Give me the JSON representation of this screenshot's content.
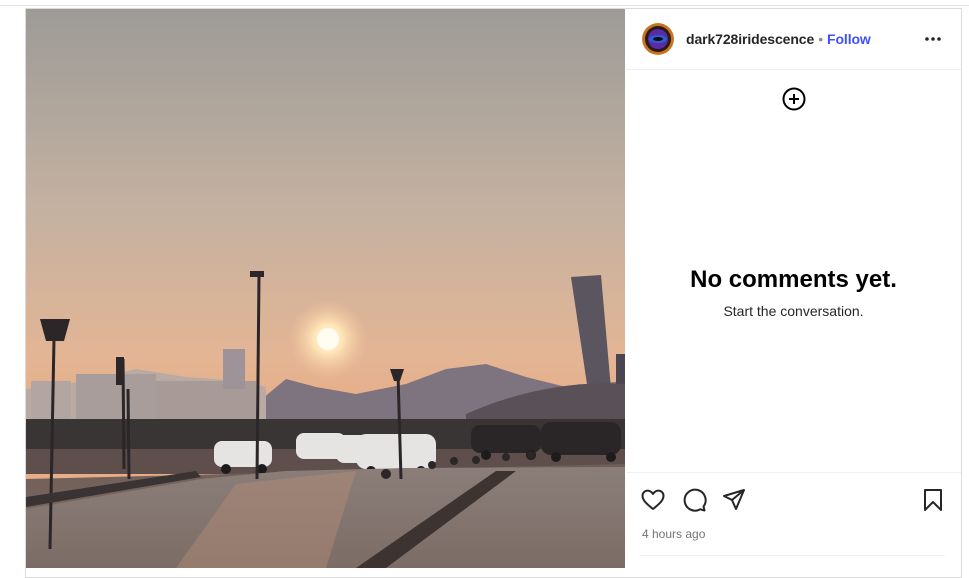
{
  "post": {
    "username": "dark728iridescence",
    "separator": "•",
    "follow_label": "Follow",
    "more_icon": "more-horizontal-icon"
  },
  "comments": {
    "empty_title": "No comments yet.",
    "empty_subtitle": "Start the conversation.",
    "add_icon": "plus-circle-icon"
  },
  "actions": {
    "like_icon": "heart-icon",
    "comment_icon": "comment-bubble-icon",
    "share_icon": "send-icon",
    "save_icon": "bookmark-icon",
    "timestamp": "4 hours ago"
  },
  "colors": {
    "accent": "#4150f7",
    "text": "#262626",
    "muted": "#737373",
    "divider": "#efefef"
  }
}
